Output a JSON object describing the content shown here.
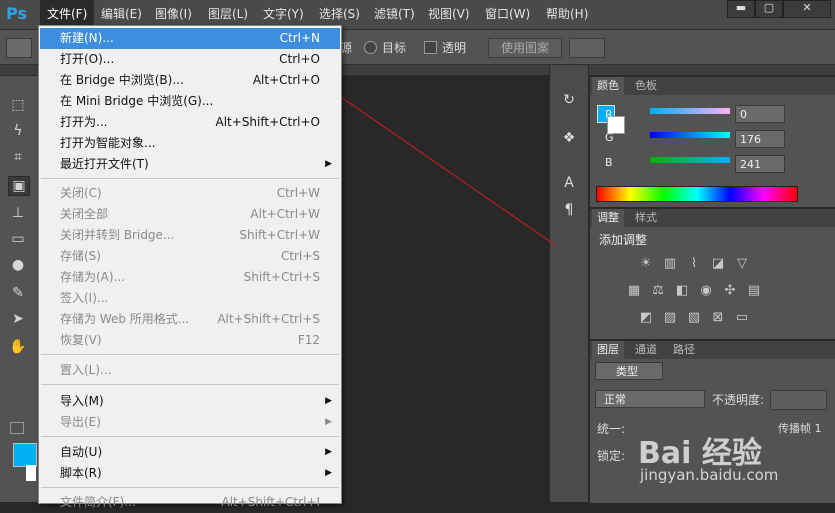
{
  "app": {
    "logo": "Ps"
  },
  "menubar": {
    "items": [
      "文件(F)",
      "编辑(E)",
      "图像(I)",
      "图层(L)",
      "文字(Y)",
      "选择(S)",
      "滤镜(T)",
      "视图(V)",
      "窗口(W)",
      "帮助(H)"
    ],
    "window_buttons": [
      "▬",
      "▢",
      "✕"
    ]
  },
  "options": {
    "source_label": "源",
    "target_label": "目标",
    "transparent_label": "透明",
    "use_pattern": "使用图案"
  },
  "file_menu": {
    "groups": [
      [
        {
          "label": "新建(N)...",
          "shortcut": "Ctrl+N",
          "highlighted": true
        },
        {
          "label": "打开(O)...",
          "shortcut": "Ctrl+O"
        },
        {
          "label": "在 Bridge 中浏览(B)...",
          "shortcut": "Alt+Ctrl+O"
        },
        {
          "label": "在 Mini Bridge 中浏览(G)...",
          "shortcut": ""
        },
        {
          "label": "打开为...",
          "shortcut": "Alt+Shift+Ctrl+O"
        },
        {
          "label": "打开为智能对象...",
          "shortcut": ""
        },
        {
          "label": "最近打开文件(T)",
          "shortcut": "",
          "submenu": true
        }
      ],
      [
        {
          "label": "关闭(C)",
          "shortcut": "Ctrl+W",
          "disabled": true
        },
        {
          "label": "关闭全部",
          "shortcut": "Alt+Ctrl+W",
          "disabled": true
        },
        {
          "label": "关闭并转到 Bridge...",
          "shortcut": "Shift+Ctrl+W",
          "disabled": true
        },
        {
          "label": "存储(S)",
          "shortcut": "Ctrl+S",
          "disabled": true
        },
        {
          "label": "存储为(A)...",
          "shortcut": "Shift+Ctrl+S",
          "disabled": true
        },
        {
          "label": "签入(I)...",
          "shortcut": "",
          "disabled": true
        },
        {
          "label": "存储为 Web 所用格式...",
          "shortcut": "Alt+Shift+Ctrl+S",
          "disabled": true
        },
        {
          "label": "恢复(V)",
          "shortcut": "F12",
          "disabled": true
        }
      ],
      [
        {
          "label": "置入(L)...",
          "shortcut": "",
          "disabled": true
        }
      ],
      [
        {
          "label": "导入(M)",
          "shortcut": "",
          "submenu": true
        },
        {
          "label": "导出(E)",
          "shortcut": "",
          "submenu": true,
          "disabled": true
        }
      ],
      [
        {
          "label": "自动(U)",
          "shortcut": "",
          "submenu": true
        },
        {
          "label": "脚本(R)",
          "shortcut": "",
          "submenu": true
        }
      ],
      [
        {
          "label": "文件简介(F)...",
          "shortcut": "Alt+Shift+Ctrl+I",
          "disabled": true
        }
      ]
    ]
  },
  "color_panel": {
    "tabs": [
      "颜色",
      "色板"
    ],
    "channels": [
      {
        "name": "R",
        "value": "0"
      },
      {
        "name": "G",
        "value": "176"
      },
      {
        "name": "B",
        "value": "241"
      }
    ],
    "foreground": "#00b0f1"
  },
  "adjust_panel": {
    "tabs": [
      "调整",
      "样式"
    ],
    "title": "添加调整"
  },
  "layers_panel": {
    "tabs": [
      "图层",
      "通道",
      "路径"
    ],
    "kind_filter": "类型",
    "blend_mode": "正常",
    "opacity_label": "不透明度:",
    "unify_label": "统一:",
    "propagate_label": "传播帧 1",
    "lock_label": "锁定:"
  },
  "watermark": {
    "brand": "Bai 经验",
    "url": "jingyan.baidu.com"
  }
}
